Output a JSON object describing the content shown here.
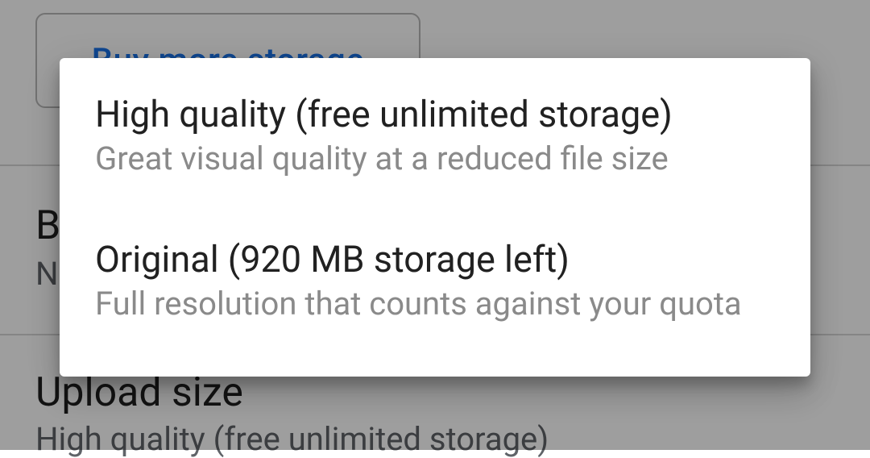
{
  "background": {
    "button_label": "Buy more storage",
    "row1": {
      "title": "Back up device folders",
      "subtitle": "None"
    },
    "row2": {
      "title": "Upload size",
      "subtitle": "High quality (free unlimited storage)"
    }
  },
  "dialog": {
    "options": [
      {
        "title": "High quality (free unlimited storage)",
        "desc": "Great visual quality at a reduced file size"
      },
      {
        "title": "Original (920 MB storage left)",
        "desc": "Full resolution that counts against your quota"
      }
    ]
  }
}
